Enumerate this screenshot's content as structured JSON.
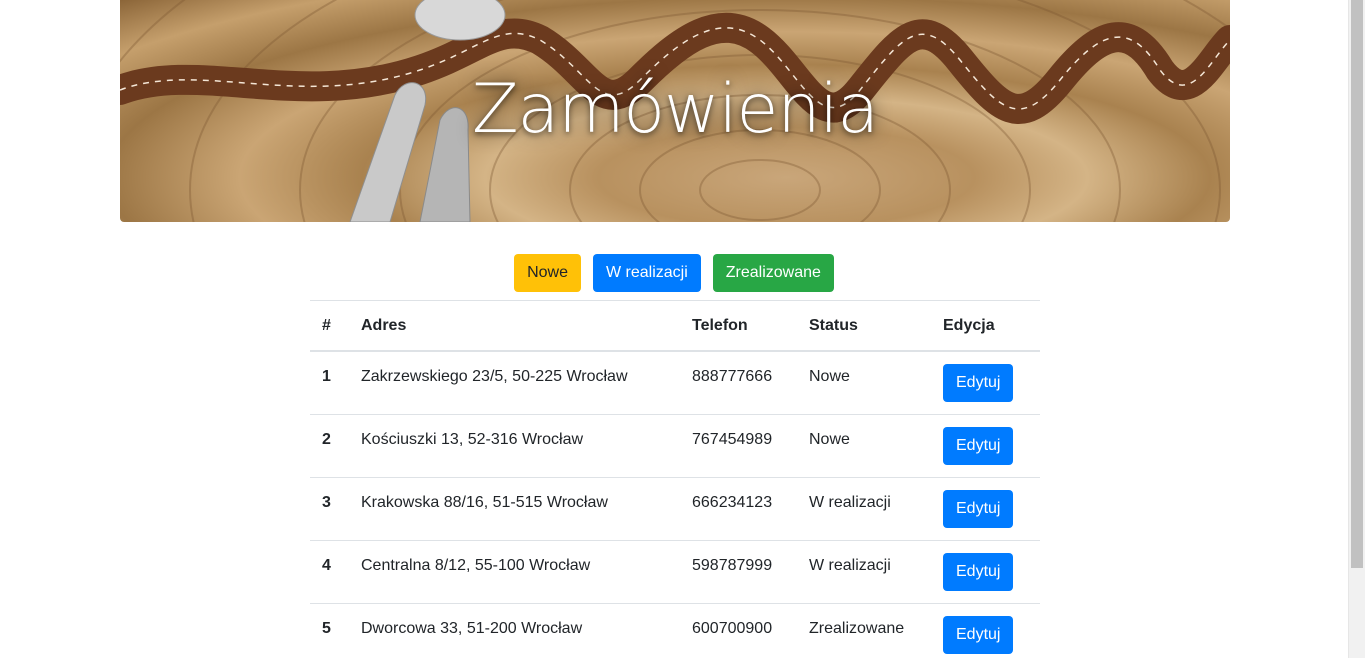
{
  "hero": {
    "title": "Zamówienia"
  },
  "filters": [
    {
      "label": "Nowe",
      "color": "#ffc107"
    },
    {
      "label": "W realizacji",
      "color": "#007bff"
    },
    {
      "label": "Zrealizowane",
      "color": "#28a745"
    }
  ],
  "table": {
    "headers": [
      "#",
      "Adres",
      "Telefon",
      "Status",
      "Edycja"
    ],
    "rows": [
      {
        "num": "1",
        "address": "Zakrzewskiego 23/5, 50-225 Wrocław",
        "phone": "888777666",
        "status": "Nowe",
        "edit": "Edytuj"
      },
      {
        "num": "2",
        "address": "Kościuszki 13, 52-316 Wrocław",
        "phone": "767454989",
        "status": "Nowe",
        "edit": "Edytuj"
      },
      {
        "num": "3",
        "address": "Krakowska 88/16, 51-515 Wrocław",
        "phone": "666234123",
        "status": "W realizacji",
        "edit": "Edytuj"
      },
      {
        "num": "4",
        "address": "Centralna 8/12, 55-100 Wrocław",
        "phone": "598787999",
        "status": "W realizacji",
        "edit": "Edytuj"
      },
      {
        "num": "5",
        "address": "Dworcowa 33, 51-200 Wrocław",
        "phone": "600700900",
        "status": "Zrealizowane",
        "edit": "Edytuj"
      }
    ]
  },
  "colors": {
    "accent": "#007bff",
    "warning": "#ffc107",
    "success": "#28a745"
  }
}
